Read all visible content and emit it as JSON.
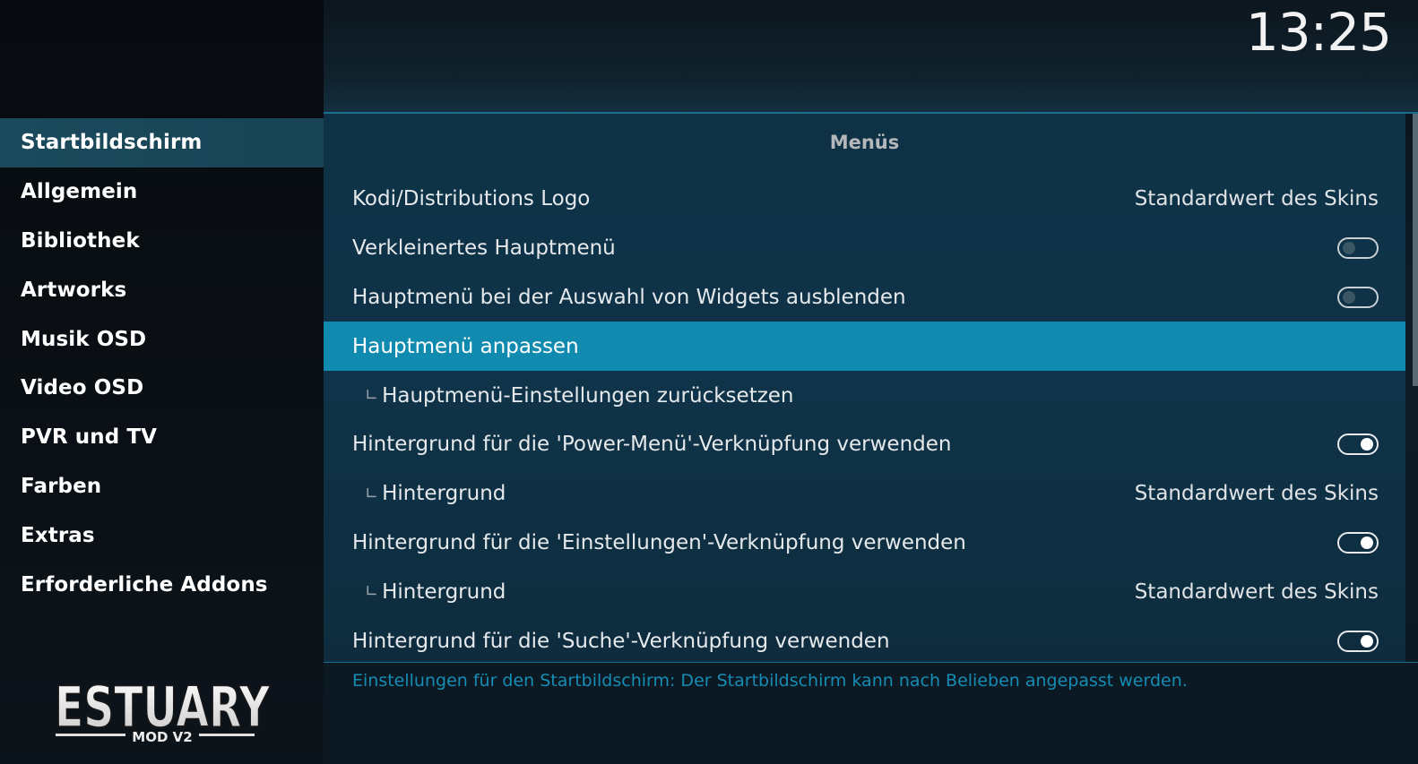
{
  "clock": "13:25",
  "sidebar": {
    "items": [
      {
        "label": "Startbildschirm"
      },
      {
        "label": "Allgemein"
      },
      {
        "label": "Bibliothek"
      },
      {
        "label": "Artworks"
      },
      {
        "label": "Musik OSD"
      },
      {
        "label": "Video OSD"
      },
      {
        "label": "PVR und TV"
      },
      {
        "label": "Farben"
      },
      {
        "label": "Extras"
      },
      {
        "label": "Erforderliche Addons"
      }
    ],
    "active_index": 0,
    "logo": {
      "title": "ESTUARY",
      "subtitle": "MOD V2"
    }
  },
  "panel": {
    "section_title": "Menüs",
    "rows": [
      {
        "label": "Kodi/Distributions Logo",
        "value": "Standardwert des Skins"
      },
      {
        "label": "Verkleinertes Hauptmenü",
        "toggle": "off"
      },
      {
        "label": "Hauptmenü bei der Auswahl von Widgets ausblenden",
        "toggle": "off"
      },
      {
        "label": "Hauptmenü anpassen",
        "selected": true
      },
      {
        "label": "Hauptmenü-Einstellungen zurücksetzen",
        "sub": true
      },
      {
        "label": "Hintergrund für die 'Power-Menü'-Verknüpfung verwenden",
        "toggle": "on"
      },
      {
        "label": "Hintergrund",
        "sub": true,
        "value": "Standardwert des Skins"
      },
      {
        "label": "Hintergrund für die 'Einstellungen'-Verknüpfung verwenden",
        "toggle": "on"
      },
      {
        "label": "Hintergrund",
        "sub": true,
        "value": "Standardwert des Skins"
      },
      {
        "label": "Hintergrund für die 'Suche'-Verknüpfung verwenden",
        "toggle": "on"
      }
    ],
    "sub_marker": "∟"
  },
  "description": "Einstellungen für den Startbildschirm: Der Startbildschirm kann nach Belieben angepasst werden.",
  "colors": {
    "accent": "#118ab0",
    "description_text": "#168cb4",
    "sidebar_active": "#1a4a5c"
  }
}
